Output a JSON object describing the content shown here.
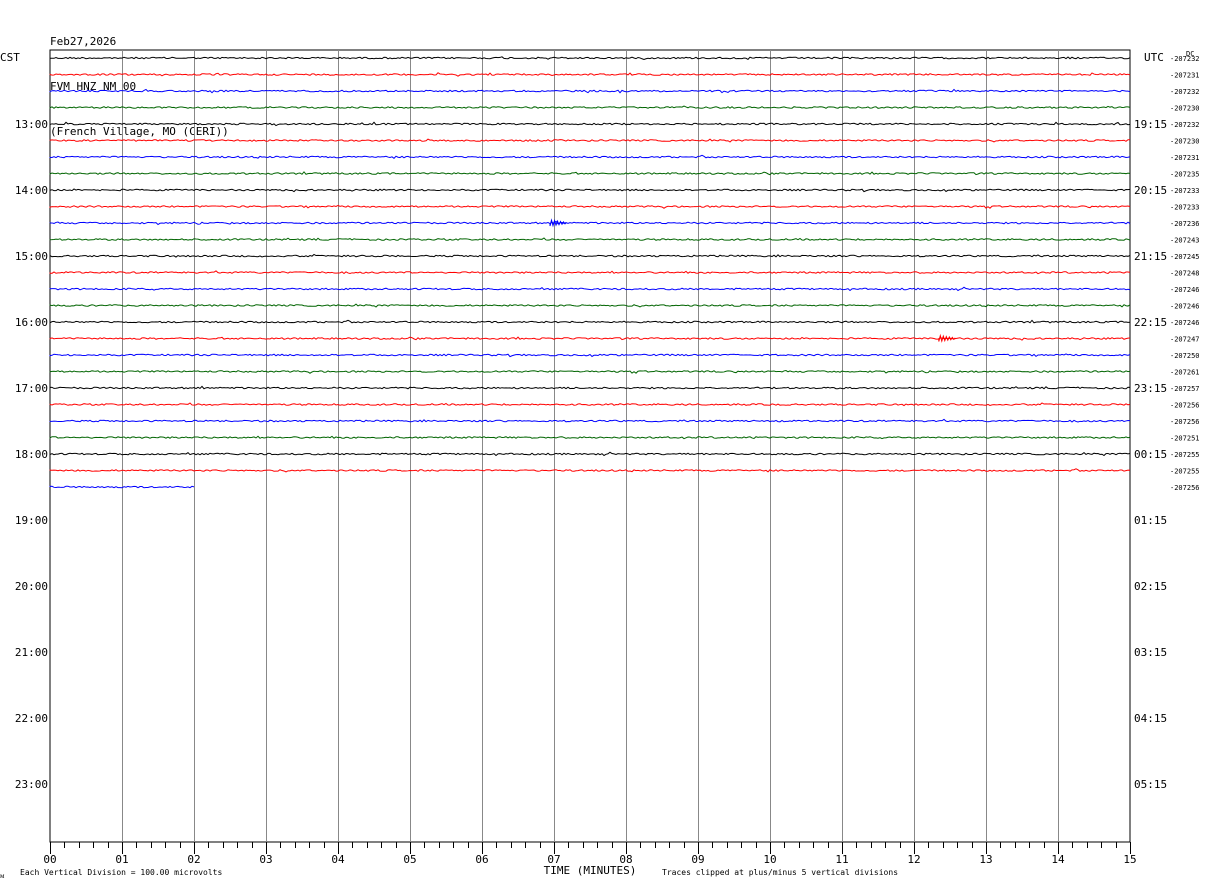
{
  "header": {
    "date": "Feb27,2026",
    "station": "FVM HNZ NM 00",
    "location": "(French Village, MO (CERI))"
  },
  "left_timezone": "CST",
  "right_timezone": "UTC",
  "right_corner_label": "DC",
  "footer": {
    "scale_note": "Each Vertical Division =  100.00 microvolts",
    "xlabel": "TIME (MINUTES)",
    "clip_note": "Traces clipped at plus/minus 5 vertical divisions",
    "corner_mark": "ᴍ"
  },
  "chart_data": {
    "type": "line",
    "title": "",
    "xlabel": "TIME (MINUTES)",
    "xlim": [
      0,
      15
    ],
    "x_ticks": [
      "00",
      "01",
      "02",
      "03",
      "04",
      "05",
      "06",
      "07",
      "08",
      "09",
      "10",
      "11",
      "12",
      "13",
      "14",
      "15"
    ],
    "left_hour_labels": [
      "13:00",
      "14:00",
      "15:00",
      "16:00",
      "17:00",
      "18:00",
      "19:00",
      "20:00",
      "21:00",
      "22:00",
      "23:00"
    ],
    "right_hour_labels": [
      "19:15",
      "20:15",
      "21:15",
      "22:15",
      "23:15",
      "00:15",
      "01:15",
      "02:15",
      "03:15",
      "04:15",
      "05:15"
    ],
    "row_minutes": 15,
    "total_rows": 48,
    "first_row_start": "12:00",
    "trace_colors": [
      "#000000",
      "#ff0000",
      "#0000ff",
      "#006400"
    ],
    "dc_offsets": [
      "-207232",
      "-207231",
      "-207232",
      "-207230",
      "-207232",
      "-207230",
      "-207231",
      "-207235",
      "-207233",
      "-207233",
      "-207236",
      "-207243",
      "-207245",
      "-207248",
      "-207246",
      "-207246",
      "-207246",
      "-207247",
      "-207250",
      "-207261",
      "-207257",
      "-207256",
      "-207256",
      "-207251",
      "-207255",
      "-207255",
      "-207256"
    ],
    "traces_recorded": 27,
    "last_trace_end_minute": 2.0,
    "events": [
      {
        "row": 10,
        "minute": 7.0,
        "amplitude": "small"
      },
      {
        "row": 17,
        "minute": 12.4,
        "amplitude": "small"
      }
    ],
    "grid": true
  }
}
